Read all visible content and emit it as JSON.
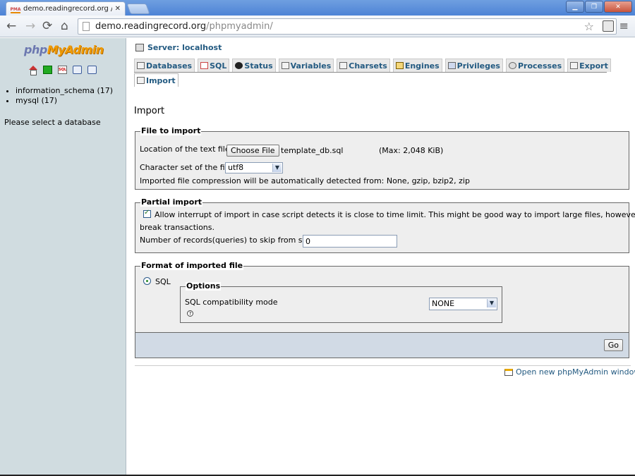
{
  "browser": {
    "tab_title": "demo.readingrecord.org / lo",
    "tab_icon_label": "PMA",
    "url_host": "demo.readingrecord.org",
    "url_path": "/phpmyadmin/"
  },
  "sidebar": {
    "logo_php": "php",
    "logo_myadmin": "MyAdmin",
    "databases": [
      {
        "label": "information_schema (17)"
      },
      {
        "label": "mysql (17)"
      }
    ],
    "hint": "Please select a database"
  },
  "header": {
    "server": "Server: localhost"
  },
  "tabs": [
    {
      "label": "Databases",
      "icon": "databases-icon"
    },
    {
      "label": "SQL",
      "icon": "sql-icon"
    },
    {
      "label": "Status",
      "icon": "status-icon"
    },
    {
      "label": "Variables",
      "icon": "variables-icon"
    },
    {
      "label": "Charsets",
      "icon": "charsets-icon"
    },
    {
      "label": "Engines",
      "icon": "engines-icon"
    },
    {
      "label": "Privileges",
      "icon": "privileges-icon"
    },
    {
      "label": "Processes",
      "icon": "processes-icon"
    },
    {
      "label": "Export",
      "icon": "export-icon"
    },
    {
      "label": "Import",
      "icon": "import-icon"
    }
  ],
  "page": {
    "title": "Import"
  },
  "file_to_import": {
    "legend": "File to import",
    "location_label": "Location of the text file",
    "choose_button": "Choose File",
    "file_name": "template_db.sql",
    "max_size": "(Max: 2,048 KiB)",
    "charset_label": "Character set of the file:",
    "charset_value": "utf8",
    "compression_note": "Imported file compression will be automatically detected from: None, gzip, bzip2, zip"
  },
  "partial_import": {
    "legend": "Partial import",
    "allow_interrupt_line1": "Allow interrupt of import in case script detects it is close to time limit. This might be good way to import large files, however it can",
    "allow_interrupt_line2": "break transactions.",
    "allow_interrupt_checked": true,
    "skip_label": "Number of records(queries) to skip from start",
    "skip_value": "0"
  },
  "format": {
    "legend": "Format of imported file",
    "sql_label": "SQL",
    "options_legend": "Options",
    "compat_label": "SQL compatibility mode",
    "compat_value": "NONE",
    "go_button": "Go"
  },
  "footer": {
    "new_window_link": "Open new phpMyAdmin window"
  }
}
